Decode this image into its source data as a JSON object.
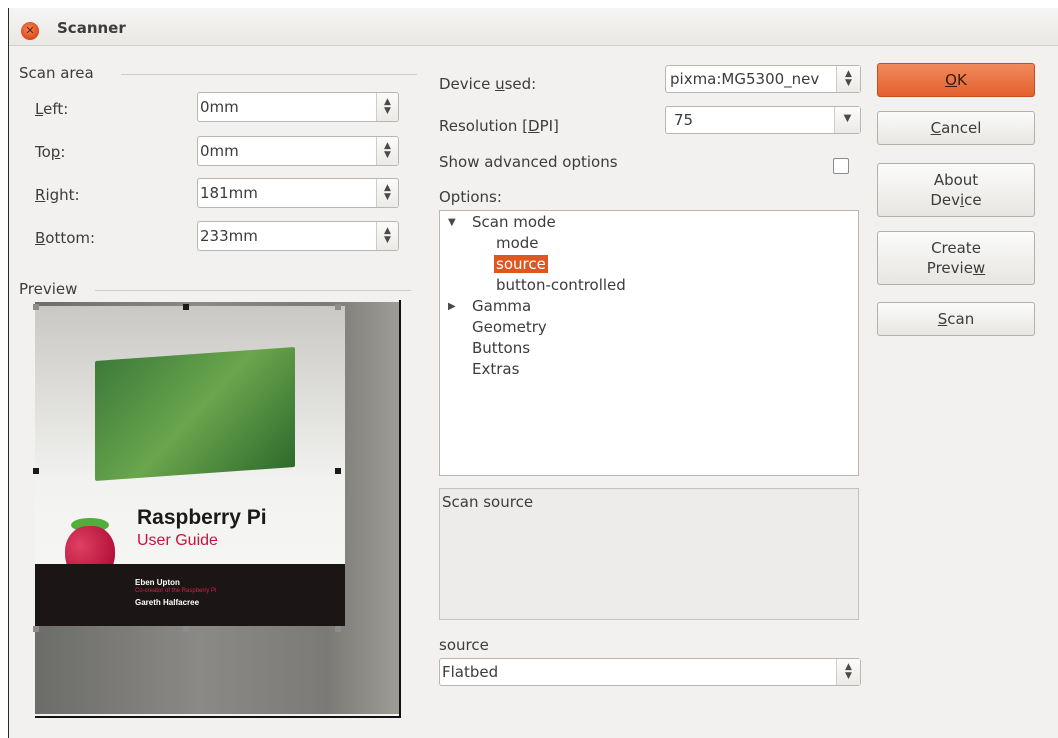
{
  "window": {
    "title": "Scanner"
  },
  "scan_area": {
    "label": "Scan area",
    "left": {
      "label_pre": "",
      "label_key": "L",
      "label_post": "eft:",
      "value": "0mm"
    },
    "top": {
      "label_pre": "To",
      "label_key": "p",
      "label_post": ":",
      "value": "0mm"
    },
    "right": {
      "label_pre": "",
      "label_key": "R",
      "label_post": "ight:",
      "value": "181mm"
    },
    "bottom": {
      "label_pre": "",
      "label_key": "B",
      "label_post": "ottom:",
      "value": "233mm"
    }
  },
  "preview": {
    "label": "Preview",
    "book": {
      "title": "Raspberry Pi",
      "subtitle": "User Guide",
      "author1": "Eben Upton",
      "author1_sub": "Co-creator of the Raspberry Pi",
      "author2": "Gareth Halfacree"
    }
  },
  "device": {
    "label_pre": "Device ",
    "label_key": "u",
    "label_post": "sed:",
    "value": "pixma:MG5300_nev"
  },
  "resolution": {
    "label_pre": "Resolution [",
    "label_key": "D",
    "label_post": "PI]",
    "value": "75"
  },
  "advanced": {
    "label": "Show advanced options",
    "checked": false
  },
  "options": {
    "label": "Options:",
    "tree": {
      "scan_mode": "Scan mode",
      "mode": "mode",
      "source": "source",
      "button_controlled": "button-controlled",
      "gamma": "Gamma",
      "geometry": "Geometry",
      "buttons": "Buttons",
      "extras": "Extras"
    },
    "description": "Scan source"
  },
  "source_field": {
    "label": "source",
    "value": "Flatbed"
  },
  "buttons": {
    "ok": {
      "key": "O",
      "rest": "K"
    },
    "cancel": {
      "key": "C",
      "rest": "ancel"
    },
    "about_line1": "About",
    "about_line2_pre": "Dev",
    "about_line2_key": "i",
    "about_line2_post": "ce",
    "preview_line1": "Create",
    "preview_line2_pre": "Previe",
    "preview_line2_key": "w",
    "preview_line2_post": "",
    "scan": {
      "key": "S",
      "rest": "can"
    }
  },
  "colors": {
    "accent": "#e4602d",
    "selection": "#e0561f"
  },
  "icons": {
    "close": "close-icon",
    "spin": "spin-arrows-icon",
    "dropdown": "chevron-down-icon",
    "expanded": "triangle-down-icon",
    "collapsed": "triangle-right-icon"
  }
}
